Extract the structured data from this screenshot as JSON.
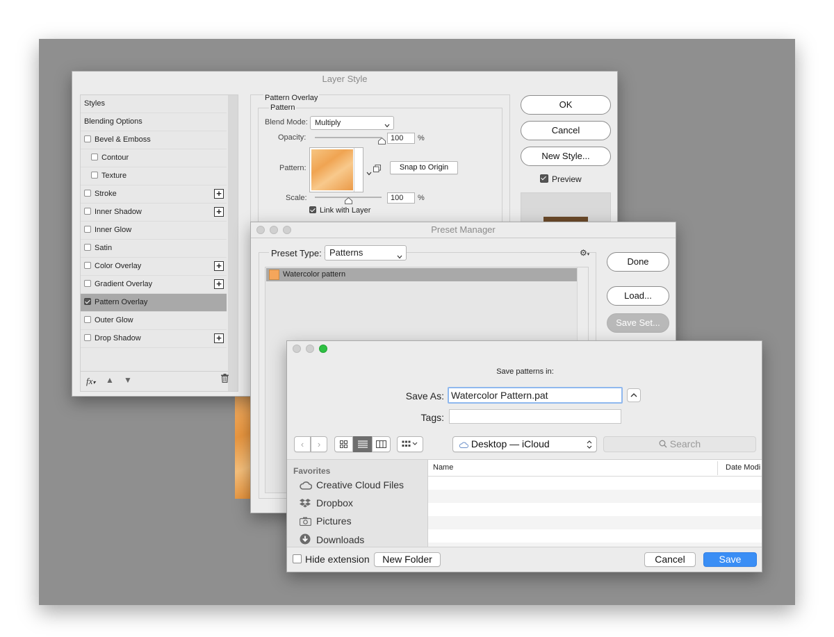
{
  "layer_style": {
    "title": "Layer Style",
    "styles": [
      {
        "label": "Styles",
        "checkbox": false,
        "checked": false,
        "plus": false,
        "indent": false
      },
      {
        "label": "Blending Options",
        "checkbox": false,
        "checked": false,
        "plus": false,
        "indent": false
      },
      {
        "label": "Bevel & Emboss",
        "checkbox": true,
        "checked": false,
        "plus": false,
        "indent": false
      },
      {
        "label": "Contour",
        "checkbox": true,
        "checked": false,
        "plus": false,
        "indent": true
      },
      {
        "label": "Texture",
        "checkbox": true,
        "checked": false,
        "plus": false,
        "indent": true
      },
      {
        "label": "Stroke",
        "checkbox": true,
        "checked": false,
        "plus": true,
        "indent": false
      },
      {
        "label": "Inner Shadow",
        "checkbox": true,
        "checked": false,
        "plus": true,
        "indent": false
      },
      {
        "label": "Inner Glow",
        "checkbox": true,
        "checked": false,
        "plus": false,
        "indent": false
      },
      {
        "label": "Satin",
        "checkbox": true,
        "checked": false,
        "plus": false,
        "indent": false
      },
      {
        "label": "Color Overlay",
        "checkbox": true,
        "checked": false,
        "plus": true,
        "indent": false
      },
      {
        "label": "Gradient Overlay",
        "checkbox": true,
        "checked": false,
        "plus": true,
        "indent": false
      },
      {
        "label": "Pattern Overlay",
        "checkbox": true,
        "checked": true,
        "plus": false,
        "indent": false,
        "selected": true
      },
      {
        "label": "Outer Glow",
        "checkbox": true,
        "checked": false,
        "plus": false,
        "indent": false
      },
      {
        "label": "Drop Shadow",
        "checkbox": true,
        "checked": false,
        "plus": true,
        "indent": false
      }
    ],
    "fx_label": "fx",
    "section_title": "Pattern Overlay",
    "group_title": "Pattern",
    "blend_mode_label": "Blend Mode:",
    "blend_mode_value": "Multiply",
    "opacity_label": "Opacity:",
    "opacity_value": "100",
    "opacity_unit": "%",
    "opacity_fraction": 1.0,
    "pattern_label": "Pattern:",
    "snap_button": "Snap to Origin",
    "scale_label": "Scale:",
    "scale_value": "100",
    "scale_unit": "%",
    "scale_fraction": 0.5,
    "link_label": "Link with Layer",
    "link_checked": true,
    "ok_button": "OK",
    "cancel_button": "Cancel",
    "new_style_button": "New Style...",
    "preview_label": "Preview",
    "preview_checked": true
  },
  "preset_manager": {
    "title": "Preset Manager",
    "preset_type_label": "Preset Type:",
    "preset_type_value": "Patterns",
    "items": [
      {
        "label": "Watercolor pattern"
      }
    ],
    "done_button": "Done",
    "load_button": "Load...",
    "save_set_button": "Save Set..."
  },
  "save_dialog": {
    "heading": "Save patterns in:",
    "save_as_label": "Save As:",
    "save_as_value": "Watercolor Pattern.pat",
    "tags_label": "Tags:",
    "location": "Desktop — iCloud",
    "search_placeholder": "Search",
    "favorites_title": "Favorites",
    "favorites": [
      {
        "label": "Creative Cloud Files",
        "icon": "creative-cloud-icon"
      },
      {
        "label": "Dropbox",
        "icon": "dropbox-icon"
      },
      {
        "label": "Pictures",
        "icon": "camera-icon"
      },
      {
        "label": "Downloads",
        "icon": "download-icon"
      }
    ],
    "columns": [
      "Name",
      "Date Modi"
    ],
    "hide_extension_label": "Hide extension",
    "new_folder_button": "New Folder",
    "cancel_button": "Cancel",
    "save_button": "Save"
  },
  "colors": {
    "accent_blue": "#3a8ef5",
    "selected_row": "#a9a9a9",
    "traffic_green": "#2ec043",
    "pattern_orange": "#f5a65b"
  }
}
